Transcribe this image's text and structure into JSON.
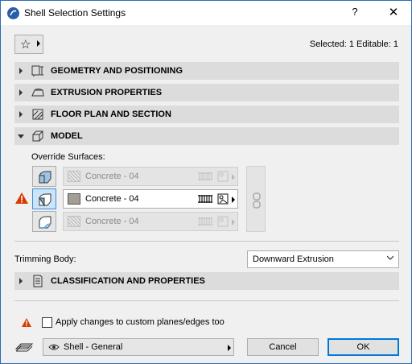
{
  "window": {
    "title": "Shell Selection Settings",
    "help_label": "?",
    "close_label": "✕"
  },
  "toolbar": {
    "favorites_icon": "star-icon",
    "selection_info": "Selected: 1 Editable: 1"
  },
  "panels": [
    {
      "label": "GEOMETRY AND POSITIONING",
      "expanded": false,
      "icon": "geometry-icon"
    },
    {
      "label": "EXTRUSION PROPERTIES",
      "expanded": false,
      "icon": "extrusion-icon"
    },
    {
      "label": "FLOOR PLAN AND SECTION",
      "expanded": false,
      "icon": "floor-plan-icon"
    },
    {
      "label": "MODEL",
      "expanded": true,
      "icon": "model-icon"
    },
    {
      "label": "CLASSIFICATION AND PROPERTIES",
      "expanded": false,
      "icon": "classification-icon"
    }
  ],
  "model": {
    "override_label": "Override Surfaces:",
    "surfaces": [
      {
        "name": "Concrete - 04",
        "enabled": false
      },
      {
        "name": "Concrete - 04",
        "enabled": true
      },
      {
        "name": "Concrete - 04",
        "enabled": false
      }
    ]
  },
  "trimming": {
    "label": "Trimming Body:",
    "value": "Downward Extrusion"
  },
  "apply_custom": {
    "label": "Apply changes to custom planes/edges too",
    "checked": false
  },
  "footer": {
    "favorite_name": "Shell - General",
    "cancel_label": "Cancel",
    "ok_label": "OK"
  },
  "colors": {
    "accent": "#0078d7",
    "warning": "#d83b01",
    "panel_bg": "#dcdcdc"
  }
}
